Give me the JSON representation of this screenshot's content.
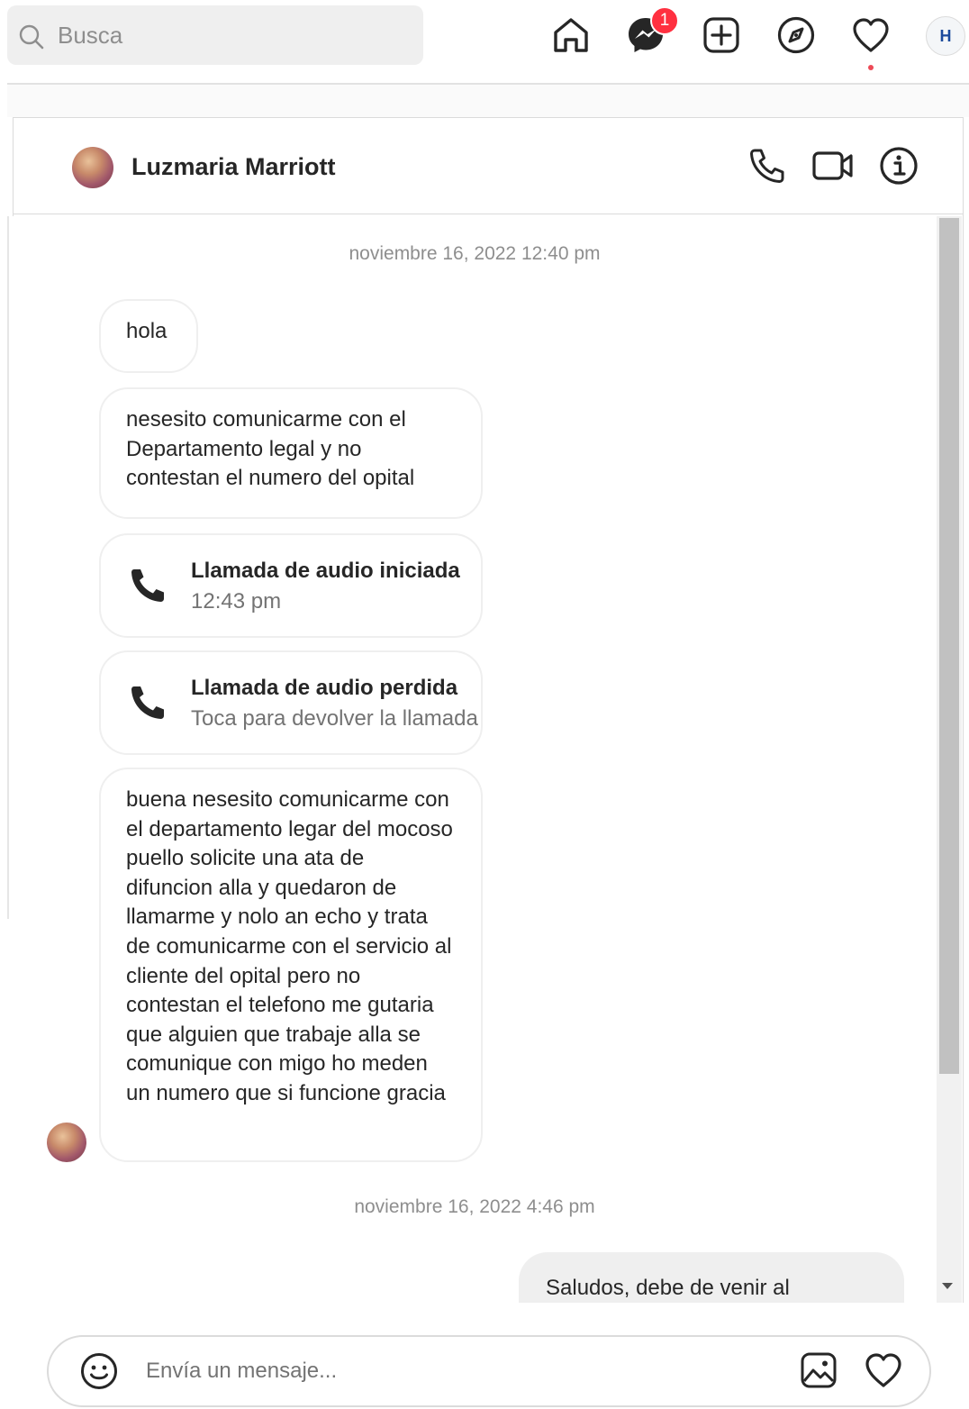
{
  "search": {
    "placeholder": "Busca",
    "icon": "search-icon"
  },
  "nav": {
    "icons": [
      "home-icon",
      "messenger-icon",
      "new-post-icon",
      "explore-icon",
      "heart-icon"
    ],
    "messenger_badge": "1",
    "profile_initial": "H"
  },
  "chat": {
    "contact_name": "Luzmaria Marriott",
    "header_icons": [
      "phone-icon",
      "video-icon",
      "info-icon"
    ],
    "timestamps": [
      "noviembre 16, 2022 12:40 pm",
      "noviembre 16, 2022 4:46 pm"
    ],
    "messages": [
      {
        "text": "hola"
      },
      {
        "text": "nesesito comunicarme con el Departamento legal y no contestan el numero del opital"
      },
      {
        "text": "buena nesesito comunicarme con el departamento legar del mocoso puello solicite una ata de difuncion alla y quedaron de llamarme y nolo an echo y trata de comunicarme con el servicio al cliente del opital pero no contestan el telefono me gutaria que alguien que trabaje alla se comunique con migo ho meden un numero que si funcione gracia"
      }
    ],
    "calls": [
      {
        "title": "Llamada de audio iniciada",
        "subtitle": "12:43 pm"
      },
      {
        "title": "Llamada de audio perdida",
        "subtitle": "Toca para devolver la llamada"
      }
    ],
    "sent_message": "Saludos, debe de venir al"
  },
  "composer": {
    "placeholder": "Envía un mensaje..."
  },
  "colors": {
    "badge": "#ff3040",
    "bubble_border": "#efefef",
    "sent_bubble": "#efefef",
    "notif_dot": "#ed4956"
  }
}
